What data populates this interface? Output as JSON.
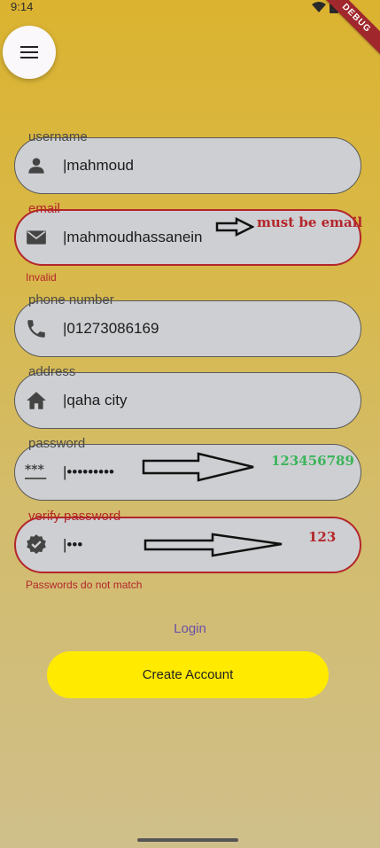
{
  "status_bar": {
    "time": "9:14",
    "debug_label": "DEBUG"
  },
  "menu": {
    "icon": "hamburger-menu-icon"
  },
  "form": {
    "username": {
      "label": "username",
      "value": "|mahmoud",
      "icon": "person-icon"
    },
    "email": {
      "label": "email",
      "value": "|mahmoudhassanein",
      "icon": "mail-icon",
      "error": "Invalid",
      "annotation": "must be email"
    },
    "phone": {
      "label": "phone number",
      "value": "|01273086169",
      "icon": "phone-icon"
    },
    "address": {
      "label": "address",
      "value": "|qaha city",
      "icon": "home-icon"
    },
    "password": {
      "label": "password",
      "value": "|•••••••••",
      "icon": "password-icon",
      "annotation": "123456789"
    },
    "verify_password": {
      "label": "verify password",
      "value": "|•••",
      "icon": "verified-icon",
      "error": "Passwords do not match",
      "annotation": "123"
    }
  },
  "actions": {
    "login_label": "Login",
    "create_label": "Create Account"
  },
  "colors": {
    "accent": "#ffea00",
    "error": "#b3262a",
    "link": "#6a4ea8",
    "green_note": "#3bb55a"
  }
}
